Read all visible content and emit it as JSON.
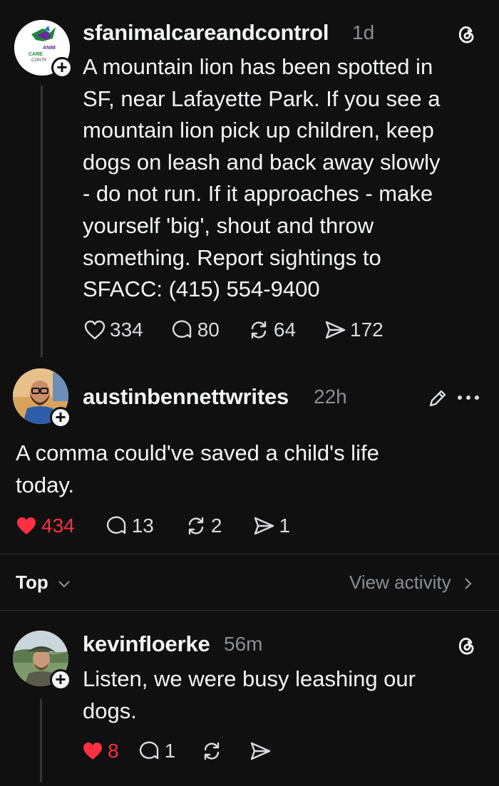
{
  "posts": [
    {
      "username": "sfanimalcareandcontrol",
      "time": "1d",
      "avatar_text": [
        "ANIM",
        "CARE",
        "CONTR"
      ],
      "text_lines": [
        "A mountain lion has been spotted in",
        "SF, near Lafayette Park. If you see a",
        "mountain lion pick up children, keep",
        "dogs on leash and back away slowly",
        "- do not run. If it approaches - make",
        "yourself 'big', shout and throw",
        "something. Report sightings to",
        "SFACC: (415) 554-9400"
      ],
      "likes": "334",
      "replies": "80",
      "reposts": "64",
      "shares": "172"
    },
    {
      "username": "austinbennettwrites",
      "time": "22h",
      "text_lines": [
        "A comma could've saved a child's life",
        "today."
      ],
      "likes": "434",
      "replies": "13",
      "reposts": "2",
      "shares": "1"
    },
    {
      "username": "kevinfloerke",
      "time": "56m",
      "text_lines": [
        "Listen, we were busy leashing our",
        "dogs."
      ],
      "likes": "8",
      "replies": "1"
    }
  ],
  "sort": {
    "label": "Top"
  },
  "activity": {
    "label": "View activity"
  },
  "colors": {
    "like_red": "#ff3040",
    "background": "#101010",
    "muted": "#8b8e92"
  }
}
